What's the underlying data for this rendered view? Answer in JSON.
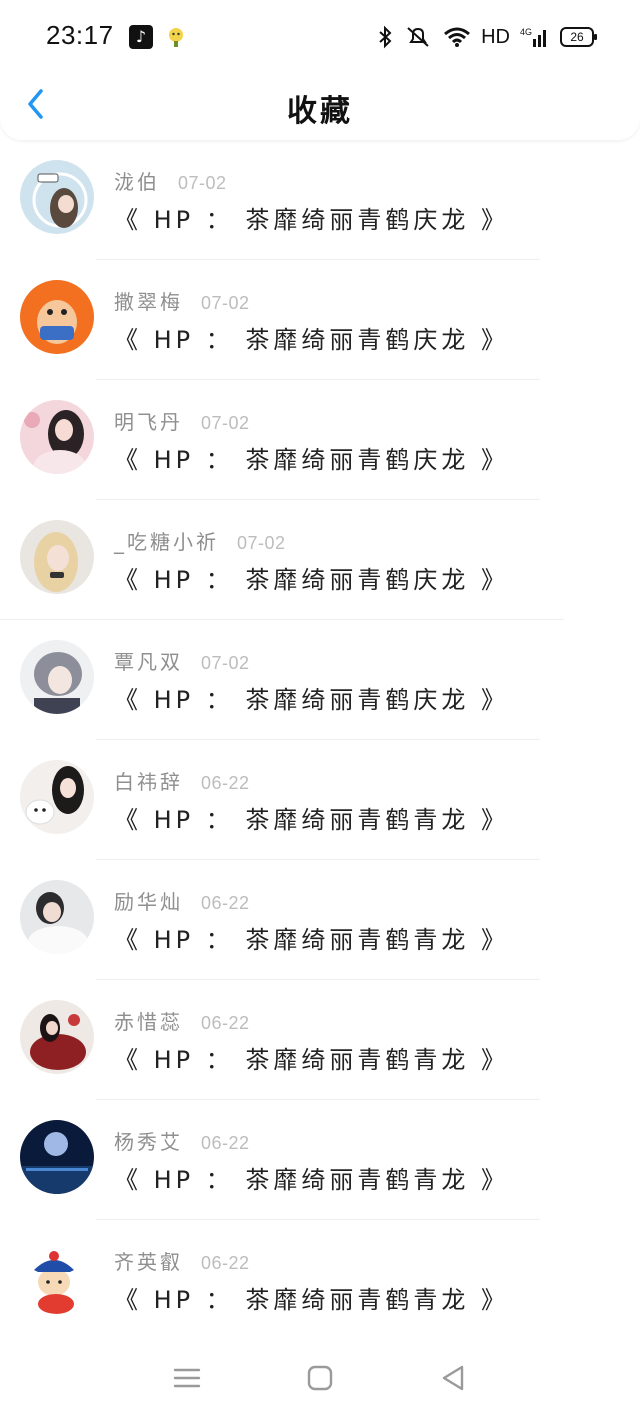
{
  "status": {
    "time": "23:17",
    "network": "HD",
    "battery": "26",
    "signal_label": "4G"
  },
  "header": {
    "title": "收藏"
  },
  "items": [
    {
      "name": "泷伯",
      "date": "07-02",
      "title": "《 HP ： 茶靡绮丽青鹤庆龙 》"
    },
    {
      "name": "撒翠梅",
      "date": "07-02",
      "title": "《 HP ： 茶靡绮丽青鹤庆龙 》"
    },
    {
      "name": "明飞丹",
      "date": "07-02",
      "title": "《 HP ： 茶靡绮丽青鹤庆龙 》"
    },
    {
      "name": "_吃糖小祈",
      "date": "07-02",
      "title": "《 HP ： 茶靡绮丽青鹤庆龙 》"
    },
    {
      "name": "覃凡双",
      "date": "07-02",
      "title": "《 HP ： 茶靡绮丽青鹤庆龙 》"
    },
    {
      "name": "白祎辞",
      "date": "06-22",
      "title": "《 HP ： 茶靡绮丽青鹤青龙 》"
    },
    {
      "name": "励华灿",
      "date": "06-22",
      "title": "《 HP ： 茶靡绮丽青鹤青龙 》"
    },
    {
      "name": "赤惜蕊",
      "date": "06-22",
      "title": "《 HP ： 茶靡绮丽青鹤青龙 》"
    },
    {
      "name": "杨秀艾",
      "date": "06-22",
      "title": "《 HP ： 茶靡绮丽青鹤青龙 》"
    },
    {
      "name": "齐英叡",
      "date": "06-22",
      "title": "《 HP ： 茶靡绮丽青鹤青龙 》"
    }
  ],
  "colors": {
    "accent": "#2196F3",
    "name_text": "#8f8f8f",
    "date_text": "#bdbdbd"
  },
  "navbar": {
    "icons": [
      "menu-icon",
      "home-square-icon",
      "back-triangle-icon"
    ]
  }
}
